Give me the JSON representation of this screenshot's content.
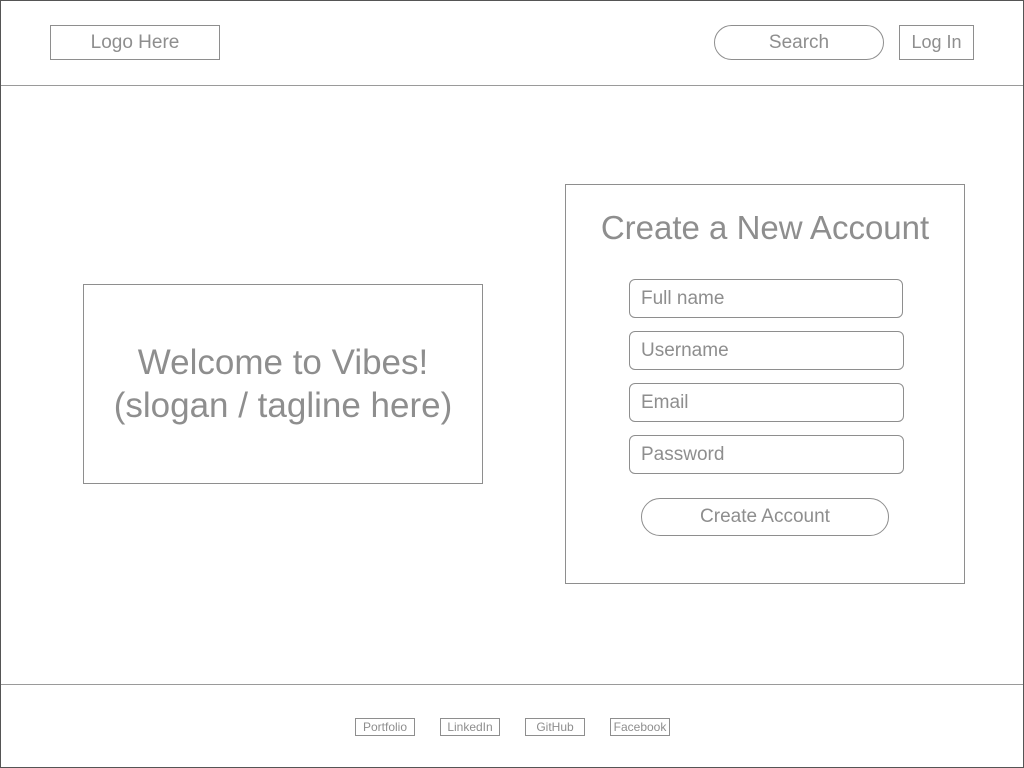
{
  "header": {
    "logo_text": "Logo Here",
    "search_label": "Search",
    "login_label": "Log In"
  },
  "welcome": {
    "line1": "Welcome to Vibes!",
    "line2": "(slogan / tagline here)"
  },
  "signup": {
    "title": "Create a New Account",
    "fields": [
      {
        "placeholder": "Full name"
      },
      {
        "placeholder": "Username"
      },
      {
        "placeholder": "Email"
      },
      {
        "placeholder": "Password"
      }
    ],
    "submit_label": "Create Account"
  },
  "footer": {
    "links": [
      {
        "label": "Portfolio"
      },
      {
        "label": "LinkedIn"
      },
      {
        "label": "GitHub"
      },
      {
        "label": "Facebook"
      }
    ]
  },
  "colors": {
    "wireframe_gray": "#8e8e8e",
    "background": "#ffffff"
  }
}
